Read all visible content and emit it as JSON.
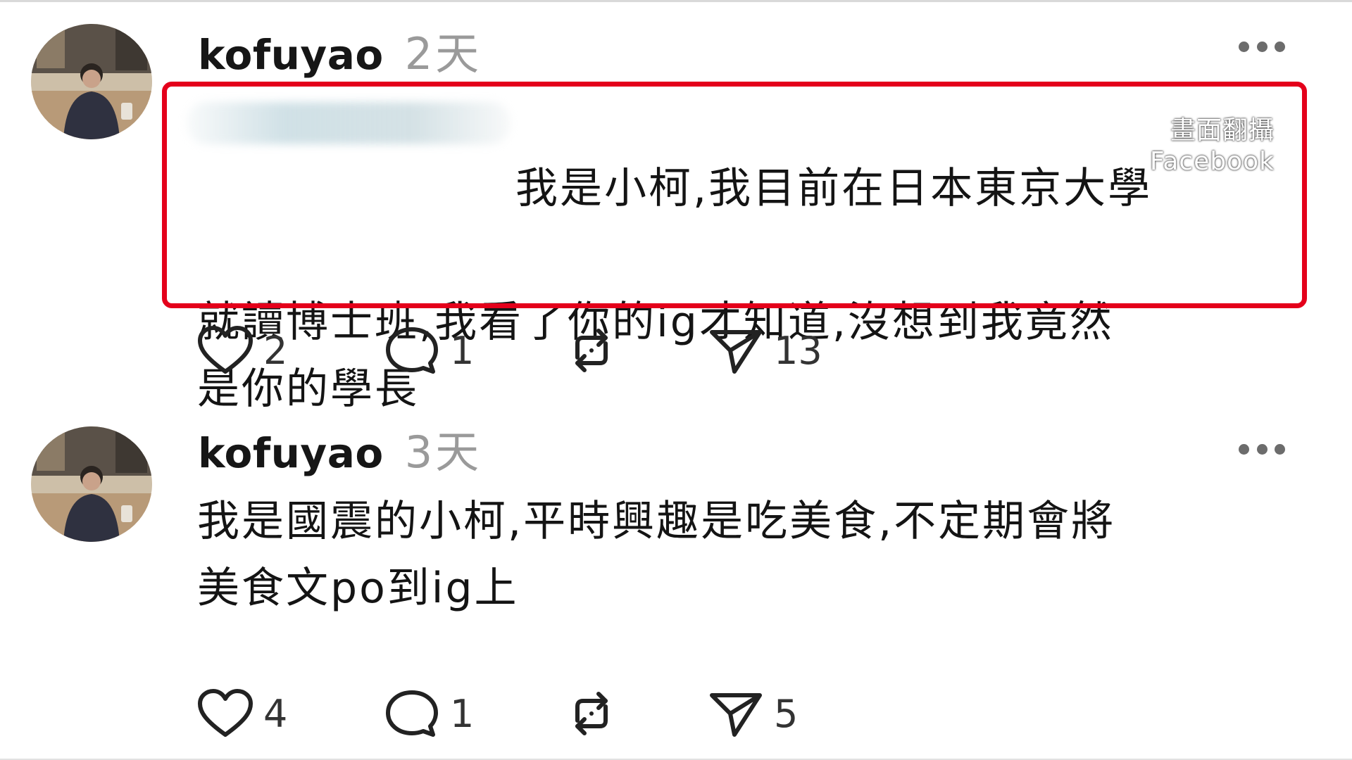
{
  "posts": [
    {
      "username": "kofuyao",
      "timestamp": "2天",
      "content_line1": "我是小柯,我目前在日本東京大學",
      "content_rest": "就讀博士班,我看了你的ig才知道,沒想到我竟然\n是你的學長",
      "has_redacted_prefix": true,
      "highlighted": true,
      "likes": "2",
      "comments": "1",
      "shares": "13"
    },
    {
      "username": "kofuyao",
      "timestamp": "3天",
      "content": "我是國震的小柯,平時興趣是吃美食,不定期會將\n美食文po到ig上",
      "likes": "4",
      "comments": "1",
      "shares": "5"
    }
  ],
  "watermark": {
    "line1": "畫面翻攝",
    "line2": "Facebook"
  },
  "colors": {
    "highlight_border": "#e4001b",
    "timestamp": "#9a9a9a",
    "text": "#141414"
  },
  "icons": [
    "more-icon",
    "heart-icon",
    "comment-icon",
    "repost-icon",
    "share-icon"
  ]
}
